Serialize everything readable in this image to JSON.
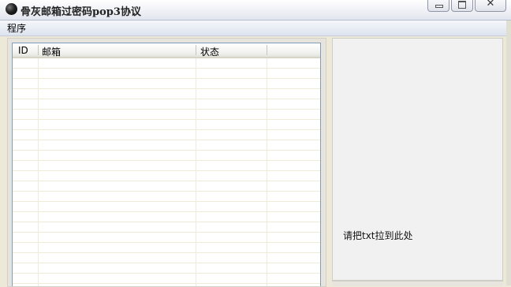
{
  "window": {
    "title": "骨灰邮箱过密码pop3协议",
    "close_symbol": "✕"
  },
  "menu": {
    "items": [
      "程序"
    ]
  },
  "list": {
    "columns": [
      "ID",
      "邮箱",
      "状态"
    ],
    "rows": []
  },
  "drop_zone": {
    "hint": "请把txt拉到此处"
  }
}
